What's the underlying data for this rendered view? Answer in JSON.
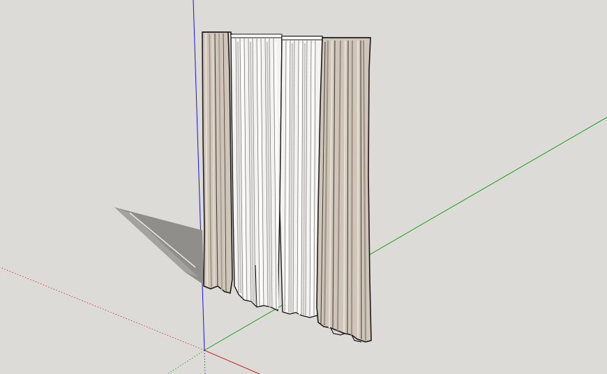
{
  "viewport": {
    "background": "#dcdbd7",
    "axes": {
      "red": "#d11f1f",
      "green": "#13a013",
      "blue": "#1515d8"
    },
    "model": {
      "name": "curtain",
      "panels": [
        {
          "name": "left-outer-drape",
          "fabric": "beige",
          "fill": "#cfc6b9"
        },
        {
          "name": "left-sheer",
          "fabric": "sheer",
          "fill": "#f4f3f1"
        },
        {
          "name": "right-sheer",
          "fabric": "sheer",
          "fill": "#f4f3f1"
        },
        {
          "name": "right-outer-drape",
          "fabric": "beige",
          "fill": "#cfc6b9"
        }
      ],
      "outline": "#1a1a1a",
      "shadow": "#8f8e8b"
    }
  }
}
